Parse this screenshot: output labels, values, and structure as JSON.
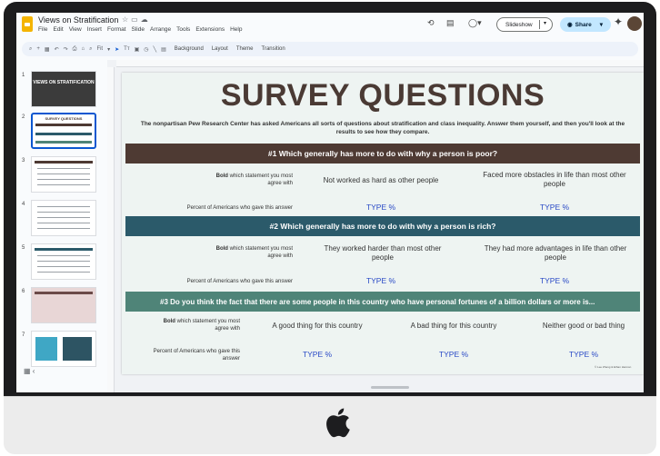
{
  "app": {
    "doc_title": "Views on Stratification",
    "menus": [
      "File",
      "Edit",
      "View",
      "Insert",
      "Format",
      "Slide",
      "Arrange",
      "Tools",
      "Extensions",
      "Help"
    ],
    "slideshow_label": "Slideshow",
    "share_label": "Share",
    "toolbar_items": [
      "Background",
      "Layout",
      "Theme",
      "Transition"
    ],
    "zoom_label": "Fit"
  },
  "filmstrip": {
    "slide_numbers": [
      "1",
      "2",
      "3",
      "4",
      "5",
      "6",
      "7"
    ],
    "thumb1_title": "VIEWS ON STRATIFICATION",
    "thumb2_title": "SURVEY QUESTIONS"
  },
  "slide": {
    "title": "SURVEY QUESTIONS",
    "intro": "The nonpartisan Pew Research Center has asked Americans all sorts of questions about stratification and class inequality. Answer them yourself, and then you'll look at the results to see how they compare.",
    "bold_word": "Bold",
    "statement_label": " which statement you most agree with",
    "percent_label": "Percent of Americans who gave this answer",
    "percent_label_q3": "Percent of Americans who gave this answer",
    "type_pct": "TYPE %",
    "credit": "© Lee Zhang & Ethan Hannon",
    "questions": [
      {
        "heading": "#1 Which generally has more to do with why a person is poor?",
        "answers": [
          "Not worked as hard as other people",
          "Faced more obstacles in life than most other people"
        ]
      },
      {
        "heading": "#2 Which generally has more to do with why a person is rich?",
        "answers": [
          "They worked harder than most other people",
          "They had more advantages in life than other people"
        ]
      },
      {
        "heading": "#3 Do you think the fact that there are some people in this country who have personal fortunes of a billion dollars or more is...",
        "answers": [
          "A good thing for this country",
          "A bad thing for this country",
          "Neither good or bad thing"
        ]
      }
    ]
  },
  "colors": {
    "q1_banner": "#4e3a33",
    "q2_banner": "#2b5a6a",
    "q3_banner": "#4f8478",
    "type_pct": "#2949c6",
    "title": "#4a3a34"
  }
}
